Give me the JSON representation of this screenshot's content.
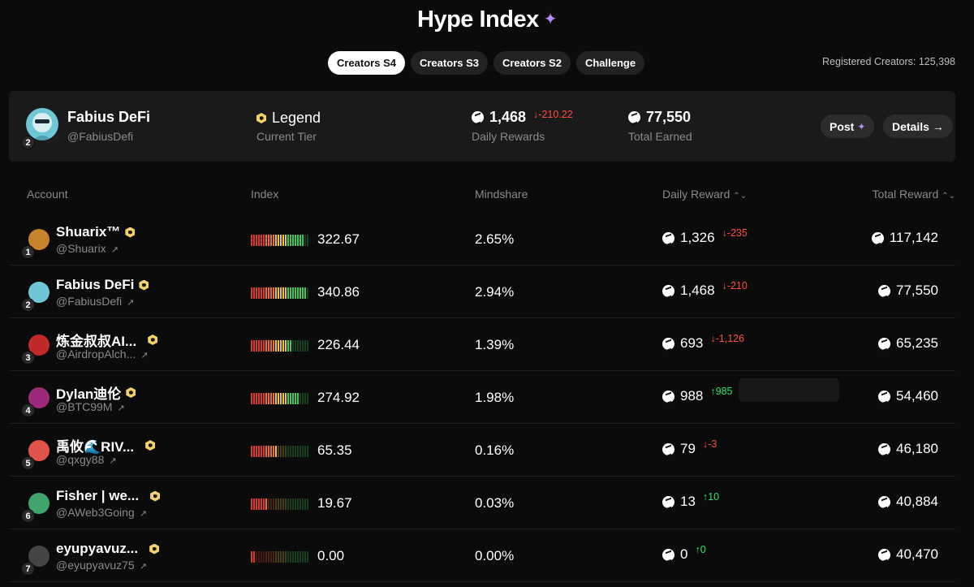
{
  "header": {
    "title": "Hype Index"
  },
  "tabs": [
    {
      "label": "Creators S4",
      "active": true
    },
    {
      "label": "Creators S3",
      "active": false
    },
    {
      "label": "Creators S2",
      "active": false
    },
    {
      "label": "Challenge",
      "active": false
    }
  ],
  "registered": "Registered Creators: 125,398",
  "profile": {
    "name": "Fabius DeFi",
    "handle": "@FabiusDefi",
    "rank": "2",
    "tier": "Legend",
    "tier_label": "Current Tier",
    "daily_rewards": "1,468",
    "daily_delta": "↓-210.22",
    "daily_label": "Daily Rewards",
    "total_earned": "77,550",
    "total_label": "Total Earned",
    "post_label": "Post",
    "details_label": "Details →"
  },
  "table": {
    "headers": {
      "account": "Account",
      "index": "Index",
      "mindshare": "Mindshare",
      "daily": "Daily Reward",
      "total": "Total Reward",
      "sort_icon": "⌃⌄"
    },
    "rows": [
      {
        "rank": "1",
        "name": "Shuarix™",
        "handle": "@Shuarix",
        "index": "322.67",
        "index_fill": 0.9,
        "mindshare": "2.65%",
        "daily": "1,326",
        "delta": "↓-235",
        "delta_dir": "neg",
        "total": "117,142",
        "avatar_color": "#c8822a"
      },
      {
        "rank": "2",
        "name": "Fabius DeFi",
        "handle": "@FabiusDefi",
        "index": "340.86",
        "index_fill": 0.95,
        "mindshare": "2.94%",
        "daily": "1,468",
        "delta": "↓-210",
        "delta_dir": "neg",
        "total": "77,550",
        "avatar_color": "#6fc7d6"
      },
      {
        "rank": "3",
        "name": "炼金叔叔AI...",
        "handle": "@AirdropAlch...",
        "index": "226.44",
        "index_fill": 0.7,
        "mindshare": "1.39%",
        "daily": "693",
        "delta": "↓-1,126",
        "delta_dir": "neg",
        "total": "65,235",
        "avatar_color": "#c22a2a"
      },
      {
        "rank": "4",
        "name": "Dylan迪伦",
        "handle": "@BTC99M",
        "index": "274.92",
        "index_fill": 0.82,
        "mindshare": "1.98%",
        "daily": "988",
        "delta": "↑985",
        "delta_dir": "pos",
        "total": "54,460",
        "avatar_color": "#9c2a7a"
      },
      {
        "rank": "5",
        "name": "禹攸🌊RIV...",
        "handle": "@qxgy88",
        "index": "65.35",
        "index_fill": 0.45,
        "mindshare": "0.16%",
        "daily": "79",
        "delta": "↓-3",
        "delta_dir": "neg",
        "total": "46,180",
        "avatar_color": "#e0534a"
      },
      {
        "rank": "6",
        "name": "Fisher | we...",
        "handle": "@AWeb3Going",
        "index": "19.67",
        "index_fill": 0.3,
        "mindshare": "0.03%",
        "daily": "13",
        "delta": "↑10",
        "delta_dir": "pos",
        "total": "40,884",
        "avatar_color": "#3fa56b"
      },
      {
        "rank": "7",
        "name": "eyupyavuz...",
        "handle": "@eyupyavuz75",
        "index": "0.00",
        "index_fill": 0.1,
        "mindshare": "0.00%",
        "daily": "0",
        "delta": "↑0",
        "delta_dir": "pos",
        "total": "40,470",
        "avatar_color": "#444444"
      }
    ]
  }
}
